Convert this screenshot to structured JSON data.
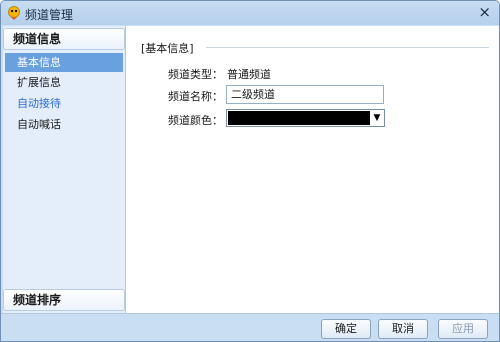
{
  "window": {
    "title": "频道管理",
    "close_label": "×"
  },
  "sidebar": {
    "group_basic": "频道信息",
    "items": [
      {
        "label": "基本信息",
        "state": "selected"
      },
      {
        "label": "扩展信息",
        "state": "normal"
      },
      {
        "label": "自动接待",
        "state": "link"
      },
      {
        "label": "自动喊话",
        "state": "normal"
      }
    ],
    "group_sort": "频道排序"
  },
  "main": {
    "section_title": "[基本信息]",
    "type_label": "频道类型：",
    "type_value": "普通频道",
    "name_label": "频道名称：",
    "name_value": "二级频道",
    "color_label": "频道颜色：",
    "color_value": "#000000",
    "color_arrow": "▼"
  },
  "footer": {
    "ok_label": "确定",
    "cancel_label": "取消",
    "apply_label": "应用"
  },
  "colors": {
    "accent": "#69a0de",
    "link": "#2b6ccf",
    "frame": "#c9def2"
  }
}
